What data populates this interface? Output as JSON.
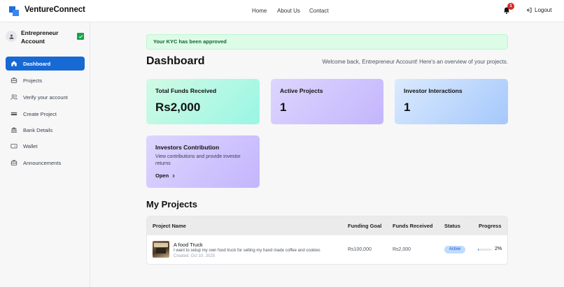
{
  "brand": {
    "name": "VentureConnect"
  },
  "nav": {
    "home": "Home",
    "about": "About Us",
    "contact": "Contact",
    "notif_count": "1",
    "logout": "Logout"
  },
  "user": {
    "name": "Entrepreneur Account"
  },
  "sidebar": {
    "items": [
      {
        "label": "Dashboard",
        "icon": "home-icon",
        "active": true
      },
      {
        "label": "Projects",
        "icon": "briefcase-icon"
      },
      {
        "label": "Verify your account",
        "icon": "users-icon"
      },
      {
        "label": "Create Project",
        "icon": "card-icon"
      },
      {
        "label": "Bank Details",
        "icon": "bank-icon"
      },
      {
        "label": "Wallet",
        "icon": "wallet-icon"
      },
      {
        "label": "Announcements",
        "icon": "briefcase-icon"
      }
    ]
  },
  "alert": {
    "text": "Your KYC has been approved"
  },
  "header": {
    "title": "Dashboard",
    "welcome": "Welcome back, Entrepreneur Account! Here's an overview of your projects."
  },
  "stats": {
    "funds": {
      "label": "Total Funds Received",
      "value": "Rs2,000"
    },
    "active": {
      "label": "Active Projects",
      "value": "1"
    },
    "interactions": {
      "label": "Investor Interactions",
      "value": "1"
    }
  },
  "contribution": {
    "title": "Investors Contribution",
    "desc": "View contributions and provide investor returns",
    "action": "Open"
  },
  "projects": {
    "title": "My Projects",
    "columns": [
      "Project Name",
      "Funding Goal",
      "Funds Received",
      "Status",
      "Progress"
    ],
    "rows": [
      {
        "name": "A food Truck",
        "desc": "I want to setup my own food truck for selling my hand made coffee and cookies",
        "created": "Created: Oct 10, 2025",
        "goal": "Rs100,000",
        "received": "Rs2,000",
        "status": "Active",
        "progress": "2%",
        "progress_fraction": 0.02
      }
    ]
  },
  "colors": {
    "primary": "#1769d4",
    "success": "#16a34a",
    "danger": "#dc2626"
  }
}
